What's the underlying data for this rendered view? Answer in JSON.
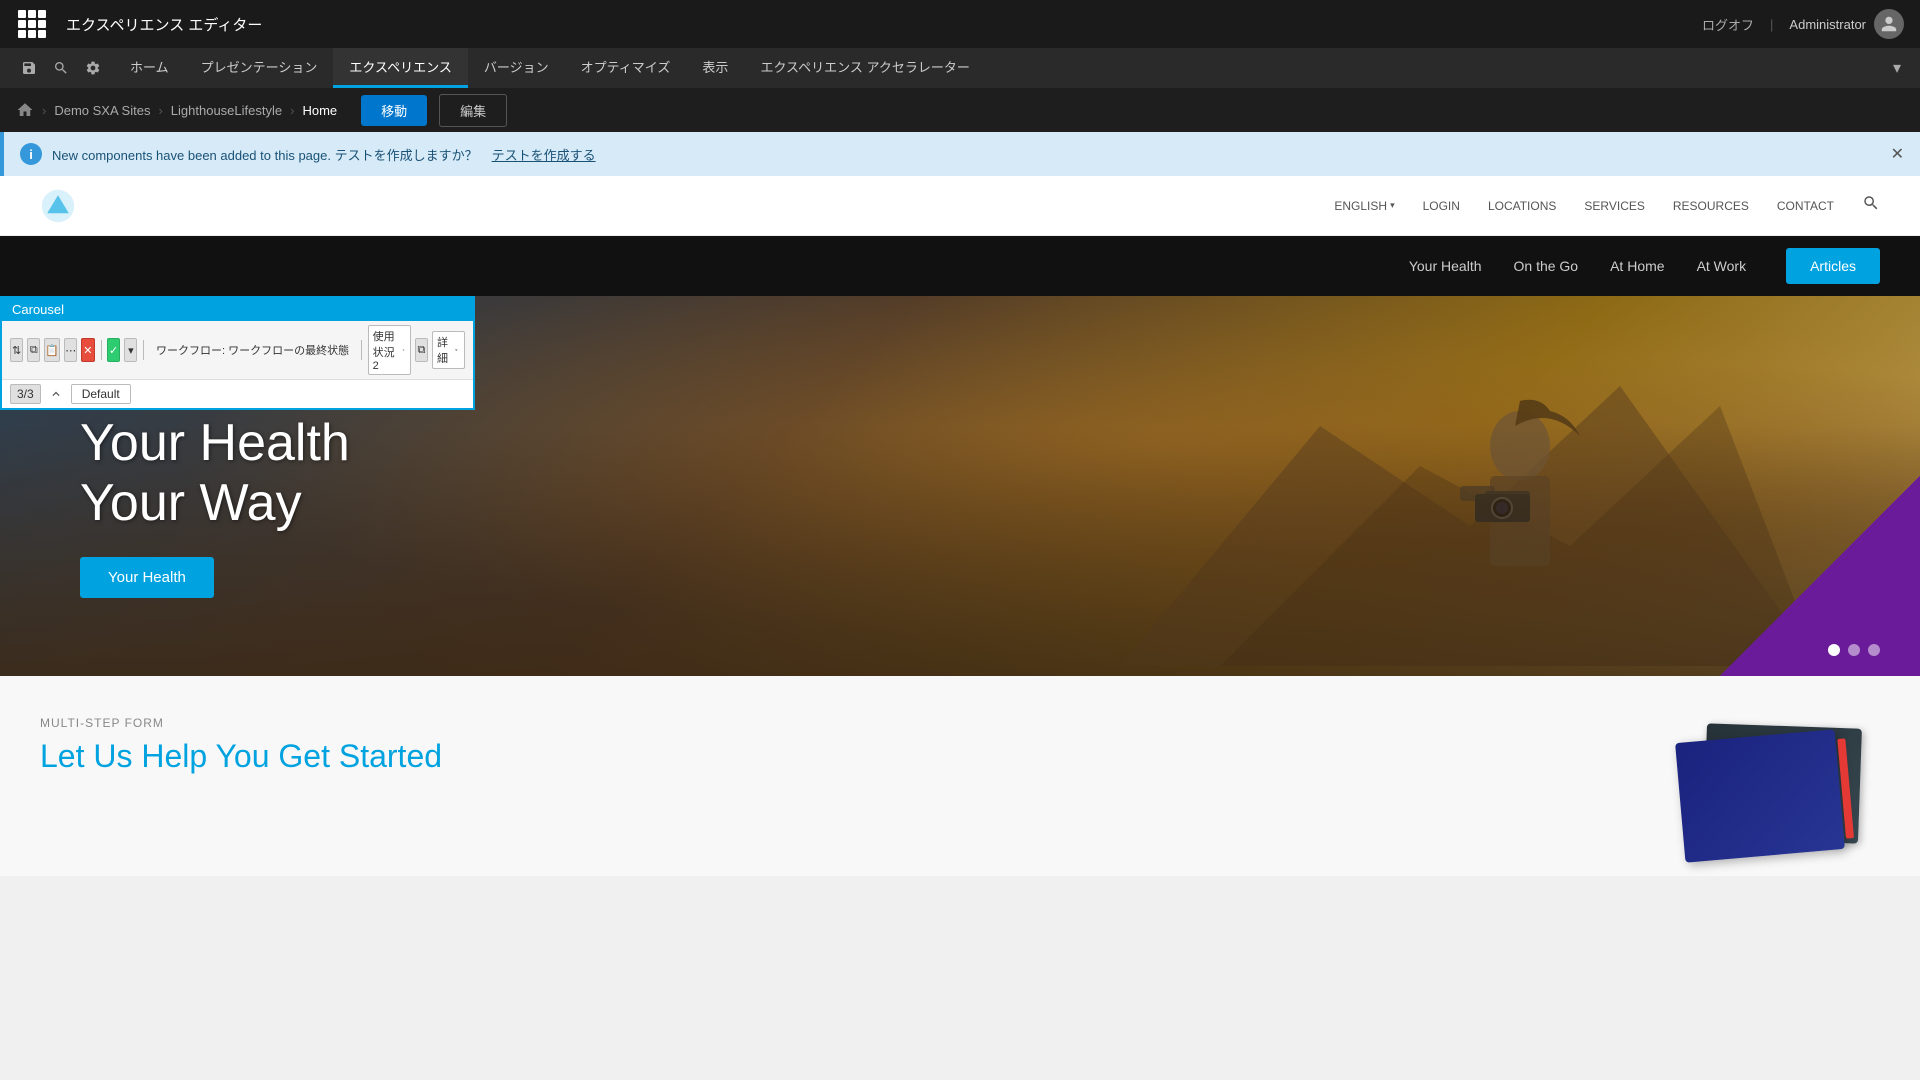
{
  "topbar": {
    "app_title": "エクスペリエンス エディター",
    "logout_label": "ログオフ",
    "divider": "|",
    "admin_label": "Administrator"
  },
  "navbar": {
    "items": [
      {
        "id": "home",
        "label": "ホーム"
      },
      {
        "id": "presentation",
        "label": "プレゼンテーション"
      },
      {
        "id": "experience",
        "label": "エクスペリエンス",
        "active": true
      },
      {
        "id": "version",
        "label": "バージョン"
      },
      {
        "id": "optimize",
        "label": "オプティマイズ"
      },
      {
        "id": "view",
        "label": "表示"
      },
      {
        "id": "accelerator",
        "label": "エクスペリエンス アクセラレーター"
      }
    ]
  },
  "breadcrumb": {
    "items": [
      {
        "label": "Demo SXA Sites"
      },
      {
        "label": "LighthouseLifestyle"
      },
      {
        "label": "Home"
      }
    ],
    "move_btn": "移動",
    "edit_btn": "編集"
  },
  "banner": {
    "message": "New components have been added to this page. テストを作成しますか？",
    "link_text": "テストを作成する"
  },
  "site_nav": {
    "small_links": [
      {
        "label": "ENGLISH"
      },
      {
        "label": "LOGIN"
      },
      {
        "label": "LOCATIONS"
      },
      {
        "label": "SERVICES"
      },
      {
        "label": "RESOURCES"
      },
      {
        "label": "CONTACT"
      }
    ]
  },
  "secondary_nav": {
    "links": [
      {
        "label": "Your Health"
      },
      {
        "label": "On the Go"
      },
      {
        "label": "At Home"
      },
      {
        "label": "At Work"
      }
    ],
    "articles_btn": "Articles"
  },
  "carousel": {
    "title": "Carousel",
    "workflow_label": "ワークフロー: ワークフローの最終状態",
    "usage_label": "使用状況 2",
    "details_label": "詳細",
    "num_label": "3/3",
    "default_label": "Default"
  },
  "hero": {
    "title_line1": "Your Health",
    "title_line2": "Your Way",
    "cta_button": "Your Health",
    "dots": [
      {
        "active": true
      },
      {
        "active": false
      },
      {
        "active": false
      }
    ]
  },
  "below_hero": {
    "form_label": "Multi-Step Form",
    "form_heading": "Let Us Help You Get Started"
  }
}
